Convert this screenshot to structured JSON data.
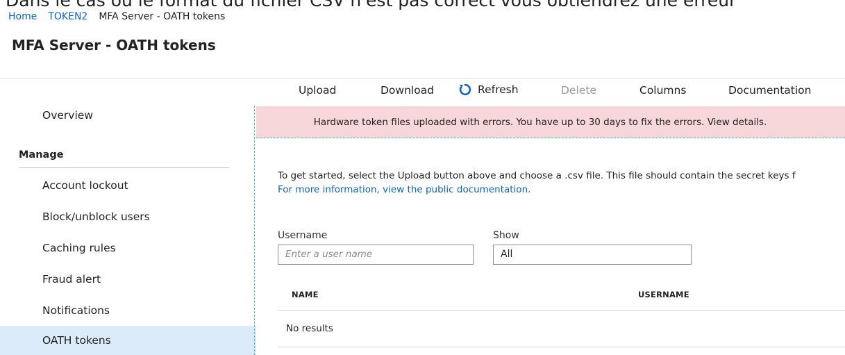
{
  "caption": "Dans le cas où le format du fichier CSV n'est pas correct vous obtiendrez une erreur",
  "breadcrumb": {
    "home": "Home",
    "tenant": "TOKEN2",
    "current": "MFA Server - OATH tokens"
  },
  "page_title": "MFA Server - OATH tokens",
  "sidebar": {
    "overview": "Overview",
    "manage_heading": "Manage",
    "items": [
      {
        "label": "Account lockout"
      },
      {
        "label": "Block/unblock users"
      },
      {
        "label": "Caching rules"
      },
      {
        "label": "Fraud alert"
      },
      {
        "label": "Notifications"
      },
      {
        "label": "OATH tokens"
      }
    ],
    "selected": "OATH tokens",
    "selected_color": "#dcebf9"
  },
  "toolbar": {
    "upload": "Upload",
    "download": "Download",
    "refresh": "Refresh",
    "delete": "Delete",
    "columns": "Columns",
    "documentation": "Documentation",
    "refresh_icon": "refresh-icon",
    "accent_color": "#0a62c9"
  },
  "error_banner": {
    "text": "Hardware token files uploaded with errors. You have up to 30 days to fix the errors. View details.",
    "color": "#f8d7da"
  },
  "intro": {
    "line1": "To get started, select the Upload button above and choose a .csv file. This file should contain the secret keys f",
    "link": "For more information, view the public documentation."
  },
  "filters": {
    "username_label": "Username",
    "username_placeholder": "Enter a user name",
    "show_label": "Show",
    "show_value": "All"
  },
  "table": {
    "columns": [
      "NAME",
      "USERNAME"
    ],
    "empty_text": "No results"
  }
}
